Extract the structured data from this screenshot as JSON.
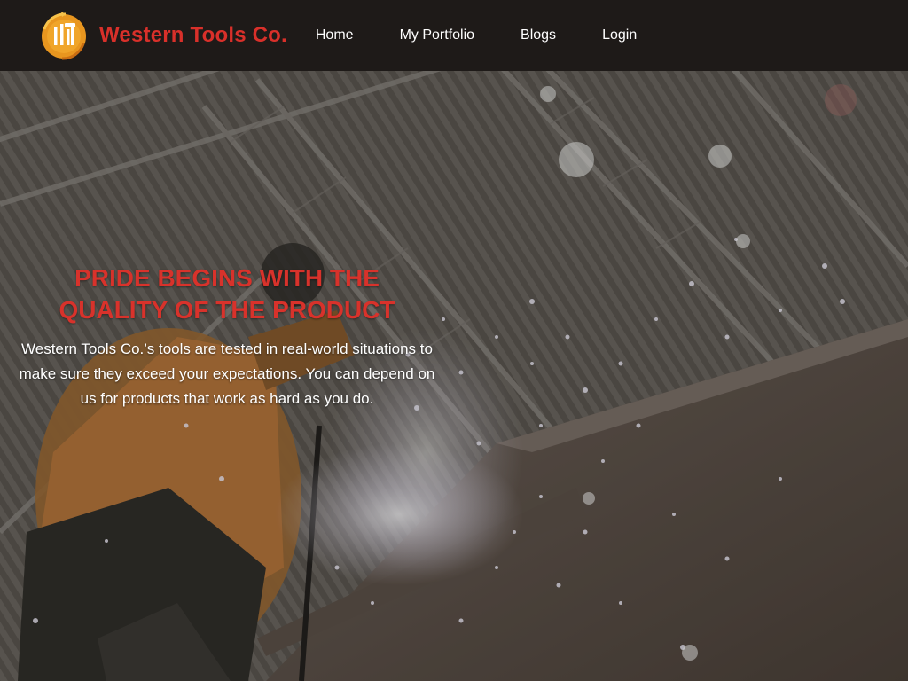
{
  "brand": {
    "name": "Western Tools Co.",
    "logo_icon": "tools-logo-icon",
    "colors": {
      "accent_red": "#d9302a",
      "logo_orange": "#e8961f",
      "nav_bg": "#1e1a18"
    }
  },
  "nav": {
    "items": [
      {
        "label": "Home"
      },
      {
        "label": "My Portfolio"
      },
      {
        "label": "Blogs"
      },
      {
        "label": "Login"
      }
    ]
  },
  "hero": {
    "image": "welder-grinding-sparks-photo",
    "headline_line1": "PRIDE BEGINS WITH THE",
    "headline_line2": "QUALITY OF THE PRODUCT",
    "tagline": "Western Tools Co.’s tools are tested in real-world situations to make sure they exceed your expectations. You can depend on us for products that work as hard as you do."
  }
}
